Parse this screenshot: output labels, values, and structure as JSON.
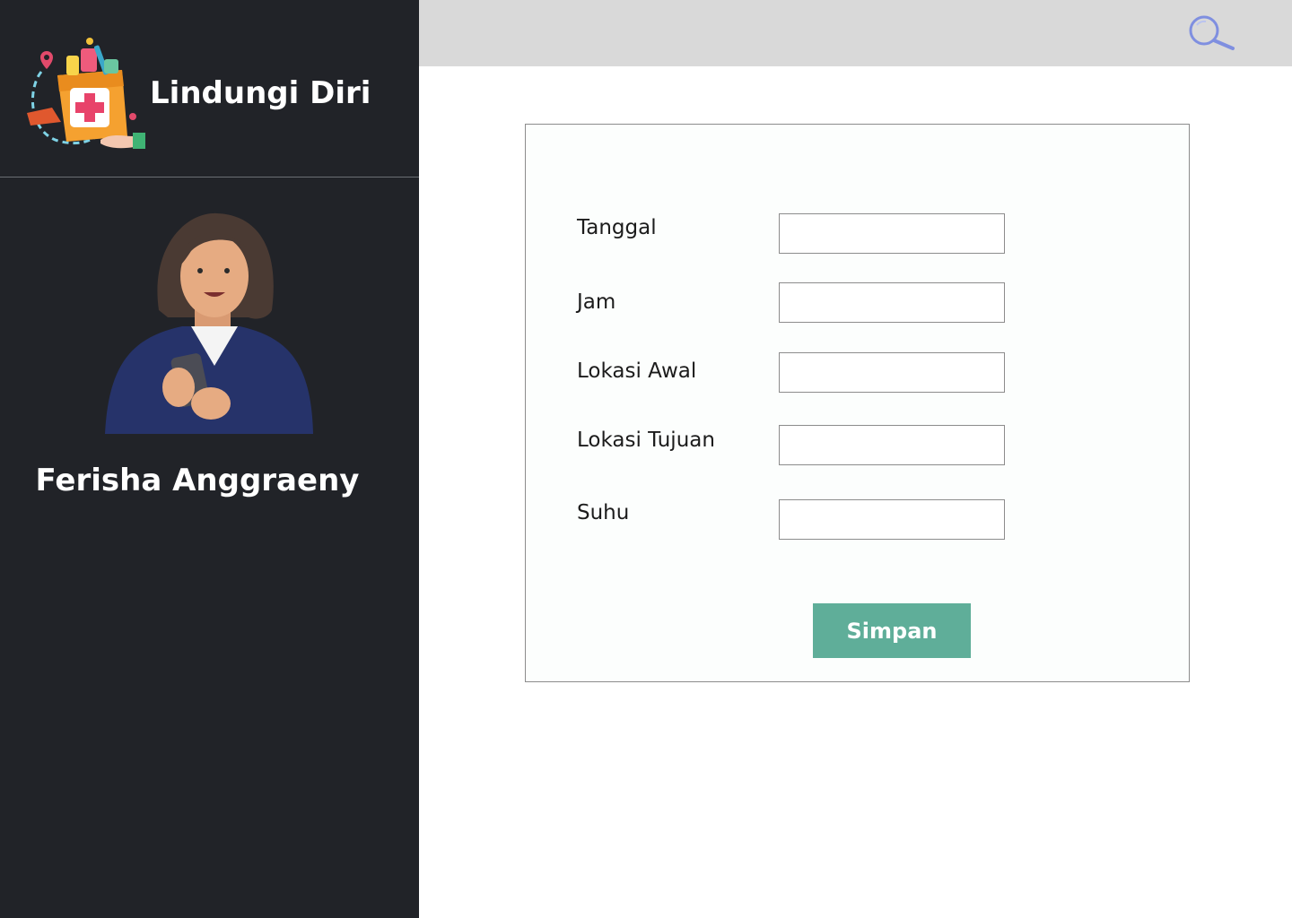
{
  "app": {
    "name": "Lindungi Diri",
    "logo_icon": "medicine-bag-icon"
  },
  "user": {
    "name": "Ferisha Anggraeny",
    "avatar_icon": "woman-with-phone-avatar"
  },
  "topbar": {
    "search_icon": "search-icon",
    "background": "#d9d9d9"
  },
  "form": {
    "fields": [
      {
        "label": "Tanggal",
        "value": ""
      },
      {
        "label": "Jam",
        "value": ""
      },
      {
        "label": "Lokasi Awal",
        "value": ""
      },
      {
        "label": "Lokasi Tujuan",
        "value": ""
      },
      {
        "label": "Suhu",
        "value": ""
      }
    ],
    "submit_label": "Simpan"
  },
  "colors": {
    "sidebar": "#212328",
    "accent": "#5fae99",
    "search_icon": "#7f8fe0"
  }
}
